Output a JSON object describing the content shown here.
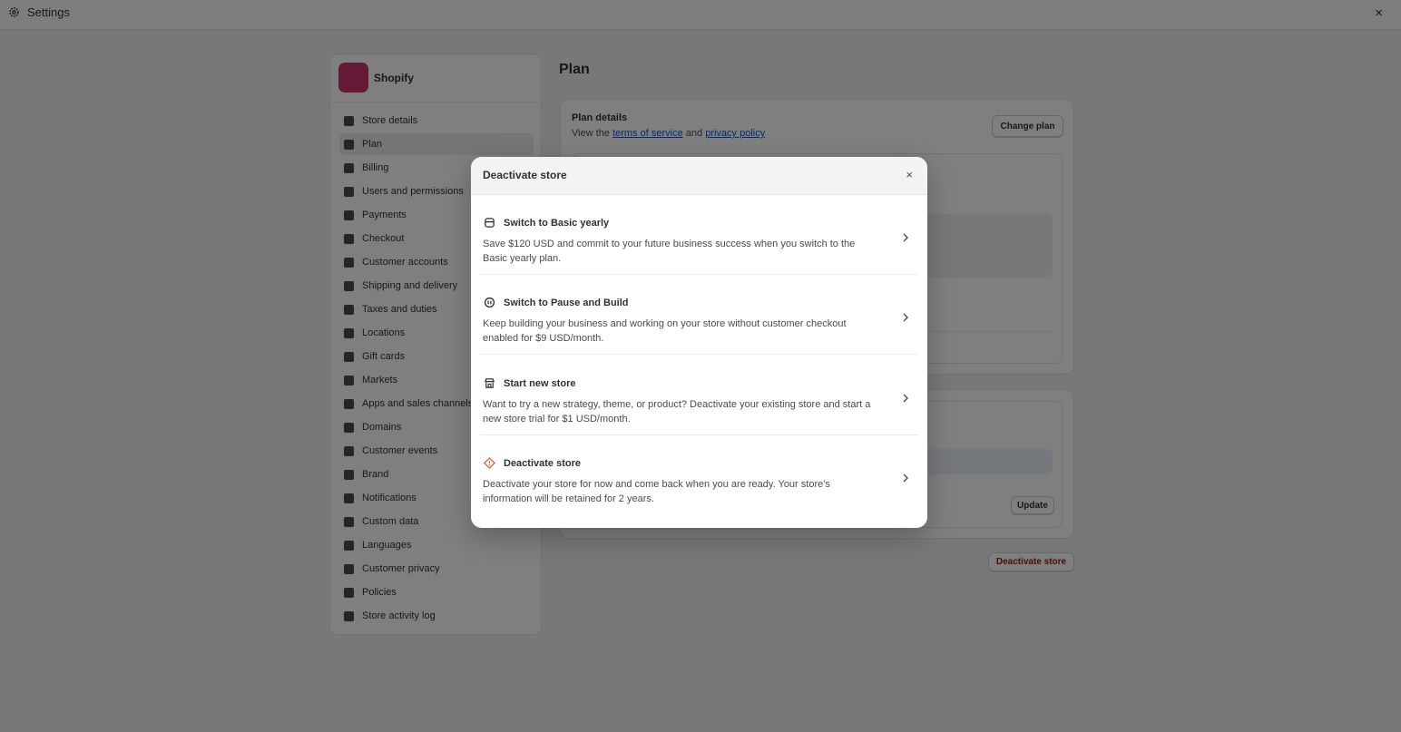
{
  "window": {
    "title": "Settings",
    "close_symbol": "×"
  },
  "store": {
    "name": "Shopify",
    "logo_color": "#c9356e"
  },
  "sidebar": {
    "items": [
      {
        "label": "Store details",
        "icon": "store-icon"
      },
      {
        "label": "Plan",
        "icon": "plan-icon",
        "active": true
      },
      {
        "label": "Billing",
        "icon": "billing-icon"
      },
      {
        "label": "Users and permissions",
        "icon": "users-icon"
      },
      {
        "label": "Payments",
        "icon": "payments-icon"
      },
      {
        "label": "Checkout",
        "icon": "cart-icon"
      },
      {
        "label": "Customer accounts",
        "icon": "person-icon"
      },
      {
        "label": "Shipping and delivery",
        "icon": "truck-icon"
      },
      {
        "label": "Taxes and duties",
        "icon": "tax-icon"
      },
      {
        "label": "Locations",
        "icon": "location-icon"
      },
      {
        "label": "Gift cards",
        "icon": "gift-card-icon"
      },
      {
        "label": "Markets",
        "icon": "globe-icon"
      },
      {
        "label": "Apps and sales channels",
        "icon": "apps-icon"
      },
      {
        "label": "Domains",
        "icon": "domains-icon"
      },
      {
        "label": "Customer events",
        "icon": "cursor-icon"
      },
      {
        "label": "Brand",
        "icon": "brand-icon"
      },
      {
        "label": "Notifications",
        "icon": "bell-icon"
      },
      {
        "label": "Custom data",
        "icon": "data-icon"
      },
      {
        "label": "Languages",
        "icon": "language-icon"
      },
      {
        "label": "Customer privacy",
        "icon": "lock-icon"
      },
      {
        "label": "Policies",
        "icon": "policy-icon"
      },
      {
        "label": "Store activity log",
        "icon": "activity-icon"
      }
    ]
  },
  "main": {
    "page_title": "Plan",
    "plan_details": {
      "heading": "Plan details",
      "sub_prefix": "View the",
      "terms_link": "terms of service",
      "and": "and",
      "privacy_link": "privacy policy",
      "change_plan": "Change plan"
    },
    "update_button": "Update",
    "deactivate_button": "Deactivate store"
  },
  "modal": {
    "title": "Deactivate store",
    "close_symbol": "×",
    "options": [
      {
        "title": "Switch to Basic yearly",
        "description": "Save $120 USD and commit to your future business success when you switch to the Basic yearly plan.",
        "icon": "calendar-icon"
      },
      {
        "title": "Switch to Pause and Build",
        "description": "Keep building your business and working on your store without customer checkout enabled for $9 USD/month.",
        "icon": "pause-icon"
      },
      {
        "title": "Start new store",
        "description": "Want to try a new strategy, theme, or product? Deactivate your existing store and start a new store trial for $1 USD/month.",
        "icon": "store-icon"
      },
      {
        "title": "Deactivate store",
        "description": "Deactivate your store for now and come back when you are ready. Your store's information will be retained for 2 years.",
        "icon": "alert-diamond-icon",
        "icon_color": "#e0633a"
      }
    ]
  }
}
